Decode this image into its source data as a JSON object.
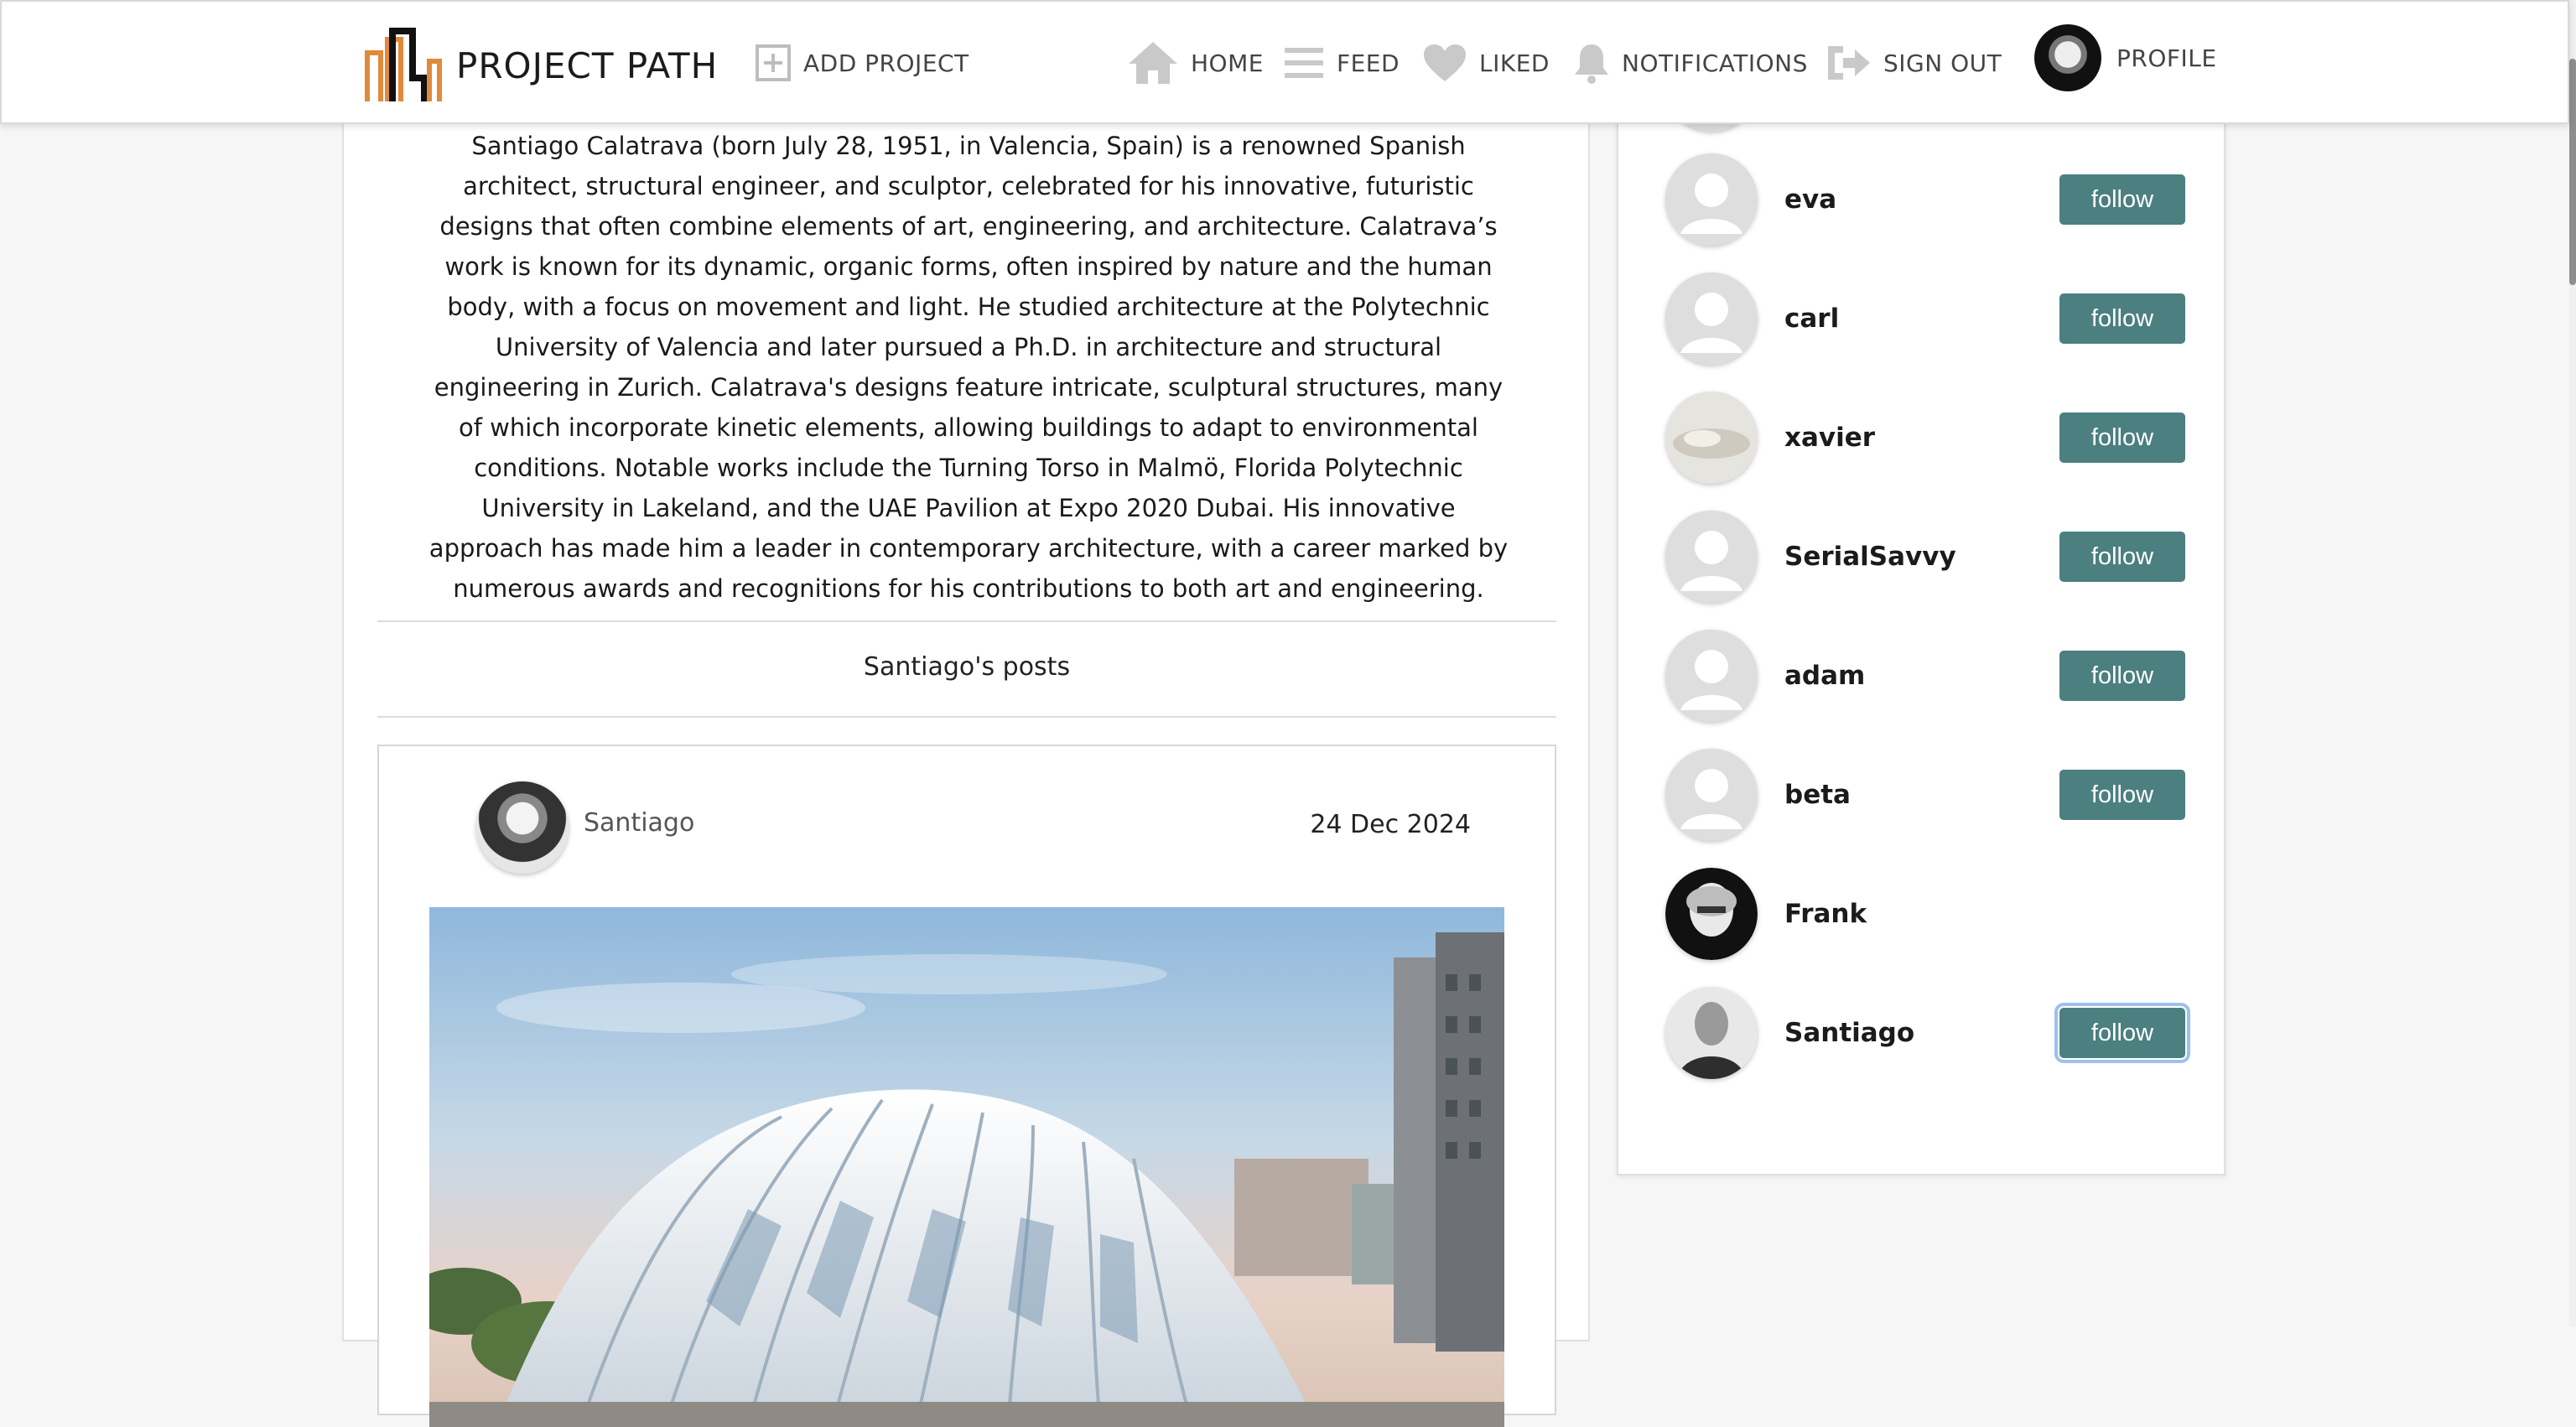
{
  "nav": {
    "brand": "PROJECT PATH",
    "add_project": "ADD PROJECT",
    "home": "HOME",
    "feed": "FEED",
    "liked": "LIKED",
    "notifications": "NOTIFICATIONS",
    "sign_out": "SIGN OUT",
    "profile": "PROFILE"
  },
  "profile": {
    "bio": "Santiago Calatrava (born July 28, 1951, in Valencia, Spain) is a renowned Spanish architect, structural engineer, and sculptor, celebrated for his innovative, futuristic designs that often combine elements of art, engineering, and architecture. Calatrava’s work is known for its dynamic, organic forms, often inspired by nature and the human body, with a focus on movement and light. He studied architecture at the Polytechnic University of Valencia and later pursued a Ph.D. in architecture and structural engineering in Zurich. Calatrava's designs feature intricate, sculptural structures, many of which incorporate kinetic elements, allowing buildings to adapt to environmental conditions. Notable works include the Turning Torso in Malmö, Florida Polytechnic University in Lakeland, and the UAE Pavilion at Expo 2020 Dubai. His innovative approach has made him a leader in contemporary architecture, with a career marked by numerous awards and recognitions for his contributions to both art and engineering.",
    "posts_heading": "Santiago's posts"
  },
  "post": {
    "author": "Santiago",
    "date": "24 Dec 2024"
  },
  "users": [
    {
      "name": "eva",
      "button": "follow"
    },
    {
      "name": "carl",
      "button": "follow"
    },
    {
      "name": "xavier",
      "button": "follow"
    },
    {
      "name": "SerialSavvy",
      "button": "follow"
    },
    {
      "name": "adam",
      "button": "follow"
    },
    {
      "name": "beta",
      "button": "follow"
    },
    {
      "name": "Frank",
      "button": ""
    },
    {
      "name": "Santiago",
      "button": "follow"
    }
  ],
  "colors": {
    "accent": "#4c7f80",
    "logo_orange": "#e08a3c",
    "page_bg": "#f6f6f6"
  }
}
